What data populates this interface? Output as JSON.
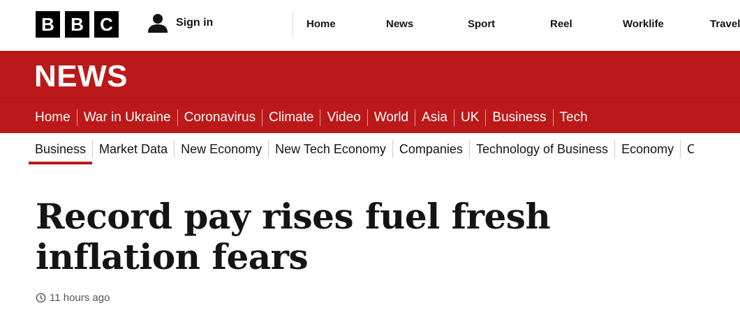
{
  "brand": {
    "logo_letters": [
      "B",
      "B",
      "C"
    ],
    "section_title": "NEWS",
    "accent_color": "#bb1919"
  },
  "account": {
    "signin_label": "Sign in",
    "icon": "user-icon"
  },
  "top_nav": {
    "items": [
      "Home",
      "News",
      "Sport",
      "Reel",
      "Worklife",
      "Travel"
    ]
  },
  "primary_nav": {
    "items": [
      "Home",
      "War in Ukraine",
      "Coronavirus",
      "Climate",
      "Video",
      "World",
      "Asia",
      "UK",
      "Business",
      "Tech"
    ],
    "active": "Business"
  },
  "secondary_nav": {
    "items": [
      "Business",
      "Market Data",
      "New Economy",
      "New Tech Economy",
      "Companies",
      "Technology of Business",
      "Economy",
      "C"
    ],
    "active": "Business"
  },
  "article": {
    "headline": "Record pay rises fuel fresh inflation fears",
    "timestamp": "11 hours ago",
    "timestamp_icon": "clock-icon"
  }
}
